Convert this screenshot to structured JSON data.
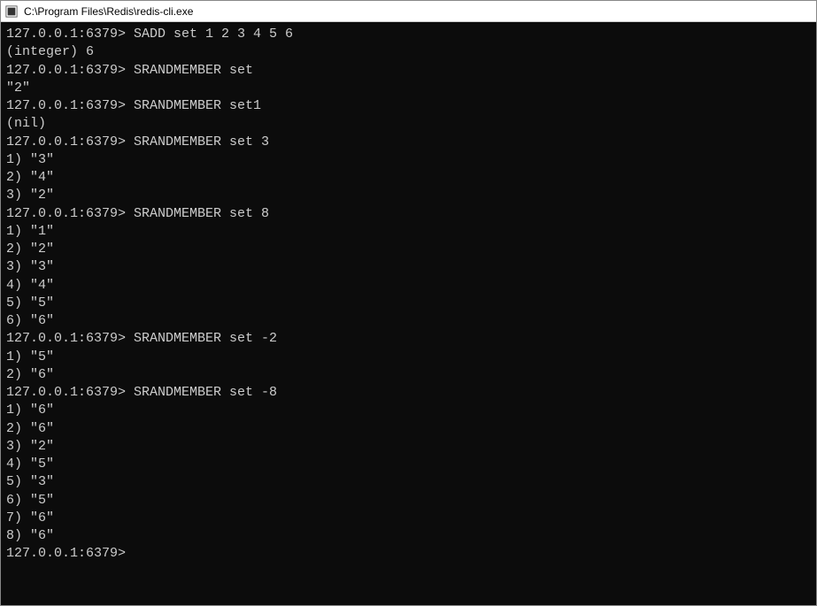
{
  "titlebar": {
    "title": "C:\\Program Files\\Redis\\redis-cli.exe"
  },
  "prompt": "127.0.0.1:6379>",
  "terminal": {
    "lines": [
      "127.0.0.1:6379> SADD set 1 2 3 4 5 6",
      "(integer) 6",
      "127.0.0.1:6379> SRANDMEMBER set",
      "\"2\"",
      "127.0.0.1:6379> SRANDMEMBER set1",
      "(nil)",
      "127.0.0.1:6379> SRANDMEMBER set 3",
      "1) \"3\"",
      "2) \"4\"",
      "3) \"2\"",
      "127.0.0.1:6379> SRANDMEMBER set 8",
      "1) \"1\"",
      "2) \"2\"",
      "3) \"3\"",
      "4) \"4\"",
      "5) \"5\"",
      "6) \"6\"",
      "127.0.0.1:6379> SRANDMEMBER set -2",
      "1) \"5\"",
      "2) \"6\"",
      "127.0.0.1:6379> SRANDMEMBER set -8",
      "1) \"6\"",
      "2) \"6\"",
      "3) \"2\"",
      "4) \"5\"",
      "5) \"3\"",
      "6) \"5\"",
      "7) \"6\"",
      "8) \"6\"",
      "127.0.0.1:6379>"
    ]
  }
}
